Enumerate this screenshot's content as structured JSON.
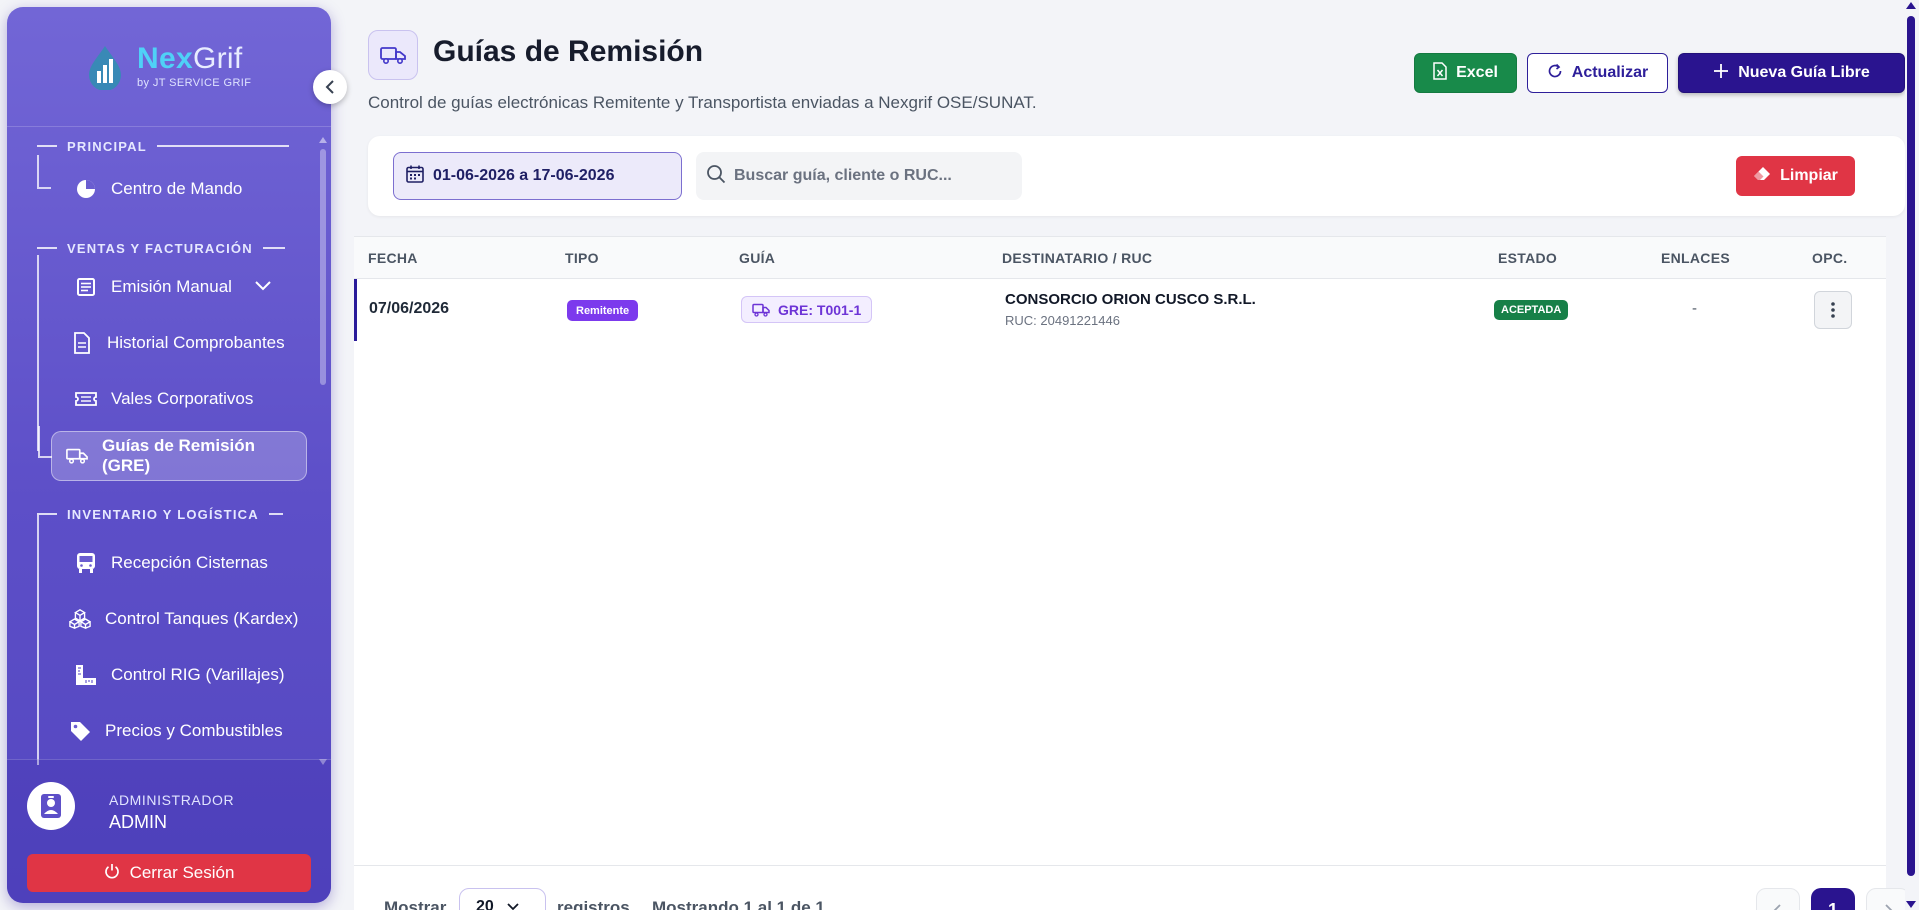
{
  "brand": {
    "name_part1": "Nex",
    "name_part2": "Grif",
    "subtitle": "by JT SERVICE GRIF"
  },
  "sidebar": {
    "sections": [
      {
        "label": "PRINCIPAL"
      },
      {
        "label": "VENTAS Y FACTURACIÓN"
      },
      {
        "label": "INVENTARIO Y LOGÍSTICA"
      }
    ],
    "items": [
      {
        "label": "Centro de Mando",
        "icon": "pie-chart-icon"
      },
      {
        "label": "Emisión Manual",
        "icon": "receipt-icon"
      },
      {
        "label": "Historial Comprobantes",
        "icon": "document-icon"
      },
      {
        "label": "Vales Corporativos",
        "icon": "ticket-icon"
      },
      {
        "label": "Guías de Remisión (GRE)",
        "icon": "truck-icon"
      },
      {
        "label": "Recepción Cisternas",
        "icon": "bus-icon"
      },
      {
        "label": "Control Tanques (Kardex)",
        "icon": "cubes-icon"
      },
      {
        "label": "Control RIG (Varillajes)",
        "icon": "ruler-icon"
      },
      {
        "label": "Precios y Combustibles",
        "icon": "tag-icon"
      }
    ],
    "active_item": "Guías de Remisión (GRE)"
  },
  "user": {
    "role": "ADMINISTRADOR",
    "name": "ADMIN",
    "logout_label": "Cerrar Sesión"
  },
  "header": {
    "title": "Guías de Remisión",
    "subtitle": "Control de guías electrónicas Remitente y Transportista enviadas a Nexgrif OSE/SUNAT."
  },
  "actions": {
    "excel": "Excel",
    "refresh": "Actualizar",
    "new": "Nueva Guía Libre"
  },
  "filters": {
    "date_range": "01-06-2026 a 17-06-2026",
    "search_placeholder": "Buscar guía, cliente o RUC...",
    "search_value": "",
    "clear_label": "Limpiar"
  },
  "table": {
    "columns": [
      "FECHA",
      "TIPO",
      "GUÍA",
      "DESTINATARIO / RUC",
      "ESTADO",
      "ENLACES",
      "OPC."
    ],
    "rows": [
      {
        "fecha": "07/06/2026",
        "tipo": "Remitente",
        "guia": "GRE: T001-1",
        "destinatario": "CONSORCIO ORION CUSCO S.R.L.",
        "ruc": "RUC: 20491221446",
        "estado": "ACEPTADA",
        "enlaces": "-"
      }
    ]
  },
  "pagination": {
    "show_label": "Mostrar",
    "page_size": "20",
    "records_label": "registros",
    "info": "Mostrando 1 al 1 de 1",
    "current_page": "1"
  },
  "colors": {
    "sidebar": "#6a5dd0",
    "primary": "#2a148f",
    "excel": "#188a4a",
    "danger": "#e03545",
    "badge_tipo": "#7c3aed",
    "badge_estado": "#178048"
  }
}
